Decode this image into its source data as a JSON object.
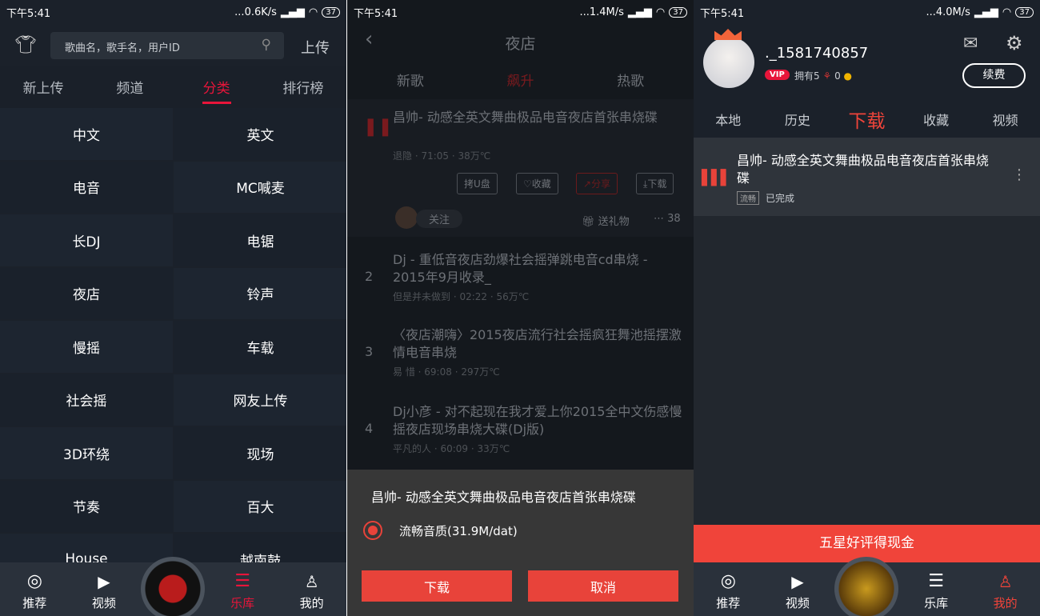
{
  "status": [
    {
      "time": "下午5:41",
      "speed": "...0.6K/s",
      "battery": "37"
    },
    {
      "time": "下午5:41",
      "speed": "...1.4M/s",
      "battery": "37"
    },
    {
      "time": "下午5:41",
      "speed": "...4.0M/s",
      "battery": "37"
    }
  ],
  "library": {
    "search_placeholder": "歌曲名，歌手名，用户ID",
    "upload": "上传",
    "tabs": [
      "新上传",
      "频道",
      "分类",
      "排行榜"
    ],
    "active_tab": "分类",
    "categories": [
      "中文",
      "英文",
      "电音",
      "MC喊麦",
      "长DJ",
      "电锯",
      "夜店",
      "铃声",
      "慢摇",
      "车载",
      "社会摇",
      "网友上传",
      "3D环绕",
      "现场",
      "节奏",
      "百大",
      "House",
      "越南鼓"
    ]
  },
  "nav": {
    "items": [
      "推荐",
      "视频",
      "乐库",
      "我的"
    ]
  },
  "club": {
    "title": "夜店",
    "tabs": [
      "新歌",
      "飙升",
      "热歌"
    ],
    "active_tab": "飙升",
    "songs": [
      {
        "rank": "",
        "title": "昌帅- 动感全英文舞曲极品电音夜店首张串烧碟",
        "artist": "退隐",
        "duration": "71:05",
        "heat": "38万℃"
      },
      {
        "rank": "2",
        "title": "Dj - 重低音夜店劲爆社会摇弹跳电音cd串烧 - 2015年9月收录_",
        "artist": "但是并未做到",
        "duration": "02:22",
        "heat": "56万℃"
      },
      {
        "rank": "3",
        "title": "〈夜店潮嗨〉2015夜店流行社会摇疯狂舞池摇摆激情电音串烧",
        "artist": "易 惜",
        "duration": "69:08",
        "heat": "297万℃"
      },
      {
        "rank": "4",
        "title": "Dj小彦 - 对不起现在我才爱上你2015全中文伤感慢摇夜店现场串烧大碟(Dj版)",
        "artist": "平凡的人",
        "duration": "60:09",
        "heat": "33万℃"
      }
    ],
    "actions": [
      "拷U盘",
      "收藏",
      "分享",
      "下载"
    ],
    "follow": "关注",
    "gift": "送礼物",
    "comments": "38",
    "sheet": {
      "title": "昌帅- 动感全英文舞曲极品电音夜店首张串烧碟",
      "option": "流畅音质(31.9M/dat)",
      "download": "下载",
      "cancel": "取消"
    }
  },
  "profile": {
    "username": "._1581740857",
    "vip": "VIP",
    "owned": "拥有5",
    "coins": "0",
    "renew": "续费",
    "tabs": [
      "本地",
      "历史",
      "下载",
      "收藏",
      "视频"
    ],
    "active_tab": "下载",
    "download": {
      "title": "昌帅- 动感全英文舞曲极品电音夜店首张串烧碟",
      "quality": "流畅",
      "state": "已完成"
    },
    "banner": "五星好评得现金"
  },
  "colors": {
    "accent": "#e8153a",
    "button": "#e8433a"
  }
}
